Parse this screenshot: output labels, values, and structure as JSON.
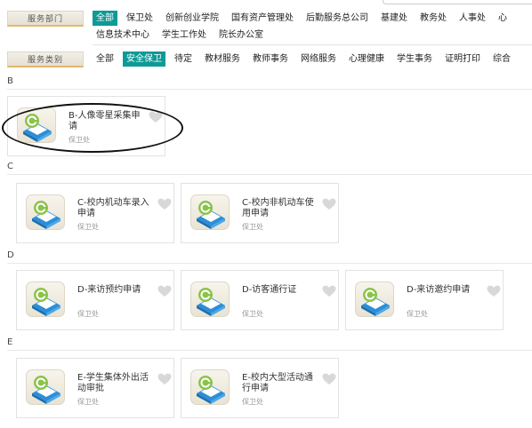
{
  "filters": {
    "department": {
      "label": "服务部门",
      "items": [
        "全部",
        "保卫处",
        "创新创业学院",
        "国有资产管理处",
        "后勤服务总公司",
        "基建处",
        "教务处",
        "人事处",
        "心",
        "信息技术中心",
        "学生工作处",
        "院长办公室"
      ],
      "active_index": 0
    },
    "category": {
      "label": "服务类别",
      "items": [
        "全部",
        "安全保卫",
        "待定",
        "教材服务",
        "教师事务",
        "网络服务",
        "心理健康",
        "学生事务",
        "证明打印",
        "综合"
      ],
      "active_index": 1
    }
  },
  "sections": [
    {
      "letter": "B",
      "cards": [
        {
          "title": "B-人像零星采集申请",
          "dept": "保卫处"
        }
      ]
    },
    {
      "letter": "C",
      "cards": [
        {
          "title": "C-校内机动车录入申请",
          "dept": "保卫处"
        },
        {
          "title": "C-校内非机动车使用申请",
          "dept": "保卫处"
        }
      ]
    },
    {
      "letter": "D",
      "cards": [
        {
          "title": "D-来访预约申请",
          "dept": "保卫处"
        },
        {
          "title": "D-访客通行证",
          "dept": "保卫处"
        },
        {
          "title": "D-来访邀约申请",
          "dept": "保卫处"
        }
      ]
    },
    {
      "letter": "E",
      "cards": [
        {
          "title": "E-学生集体外出活动审批",
          "dept": "保卫处"
        },
        {
          "title": "E-校内大型活动通行申请",
          "dept": "保卫处"
        }
      ]
    }
  ],
  "colors": {
    "accent": "#0e9a97",
    "label_underline": "#e0b96b"
  },
  "icons": {
    "app": "app-icon",
    "favorite": "heart-icon"
  }
}
